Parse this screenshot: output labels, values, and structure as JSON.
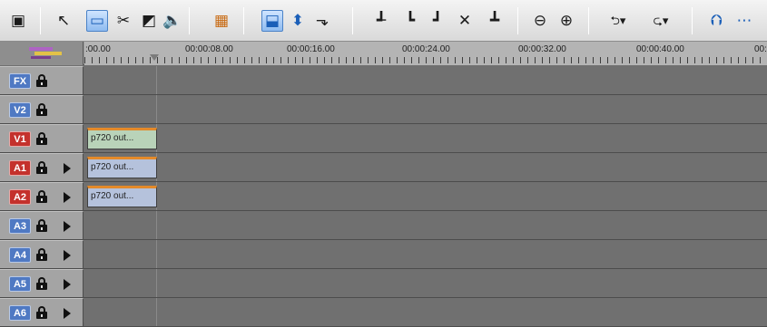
{
  "toolbar": {
    "buttons": [
      {
        "name": "save-icon",
        "glyph": "▣"
      },
      {
        "name": "select-arrow-icon",
        "glyph": "↖"
      },
      {
        "name": "trim-mode-icon",
        "glyph": "▭"
      },
      {
        "name": "cut-scissors-icon",
        "glyph": "✂"
      },
      {
        "name": "transition-icon",
        "glyph": "◩"
      },
      {
        "name": "audio-speaker-icon",
        "glyph": "🔈"
      },
      {
        "name": "render-icon",
        "glyph": "▦"
      },
      {
        "name": "overwrite-mode-icon",
        "glyph": "⬓"
      },
      {
        "name": "insert-mode-icon",
        "glyph": "⬍"
      },
      {
        "name": "ripple-mode-icon",
        "glyph": "⬎"
      },
      {
        "name": "split-clip-icon",
        "glyph": "┹"
      },
      {
        "name": "trim-start-icon",
        "glyph": "┗"
      },
      {
        "name": "trim-end-icon",
        "glyph": "┛"
      },
      {
        "name": "delete-icon",
        "glyph": "✕"
      },
      {
        "name": "group-icon",
        "glyph": "┻"
      },
      {
        "name": "zoom-out-icon",
        "glyph": "⊖"
      },
      {
        "name": "zoom-in-icon",
        "glyph": "⊕"
      },
      {
        "name": "undo-icon",
        "glyph": "⮌▾"
      },
      {
        "name": "redo-icon",
        "glyph": "⮎▾"
      },
      {
        "name": "export-icon",
        "glyph": "⮉"
      },
      {
        "name": "more-menu-icon",
        "glyph": "⋯"
      }
    ]
  },
  "ruler": {
    "labels": [
      ":00.00",
      "00:00:08.00",
      "00:00:16.00",
      "00:00:24.00",
      "00:00:32.00",
      "00:00:40.00",
      "00:"
    ]
  },
  "tracks": [
    {
      "id": "FX",
      "color": "#4f79c3",
      "lock": true,
      "expand": false,
      "clip": ""
    },
    {
      "id": "V2",
      "color": "#4f79c3",
      "lock": true,
      "expand": false,
      "clip": ""
    },
    {
      "id": "V1",
      "color": "#c4312c",
      "lock": true,
      "expand": false,
      "clip": "p720 out..."
    },
    {
      "id": "A1",
      "color": "#c4312c",
      "lock": true,
      "expand": true,
      "clip": "p720 out..."
    },
    {
      "id": "A2",
      "color": "#c4312c",
      "lock": true,
      "expand": true,
      "clip": "p720 out..."
    },
    {
      "id": "A3",
      "color": "#4f79c3",
      "lock": true,
      "expand": true,
      "clip": ""
    },
    {
      "id": "A4",
      "color": "#4f79c3",
      "lock": true,
      "expand": true,
      "clip": ""
    },
    {
      "id": "A5",
      "color": "#4f79c3",
      "lock": true,
      "expand": true,
      "clip": ""
    },
    {
      "id": "A6",
      "color": "#4f79c3",
      "lock": true,
      "expand": true,
      "clip": ""
    }
  ]
}
